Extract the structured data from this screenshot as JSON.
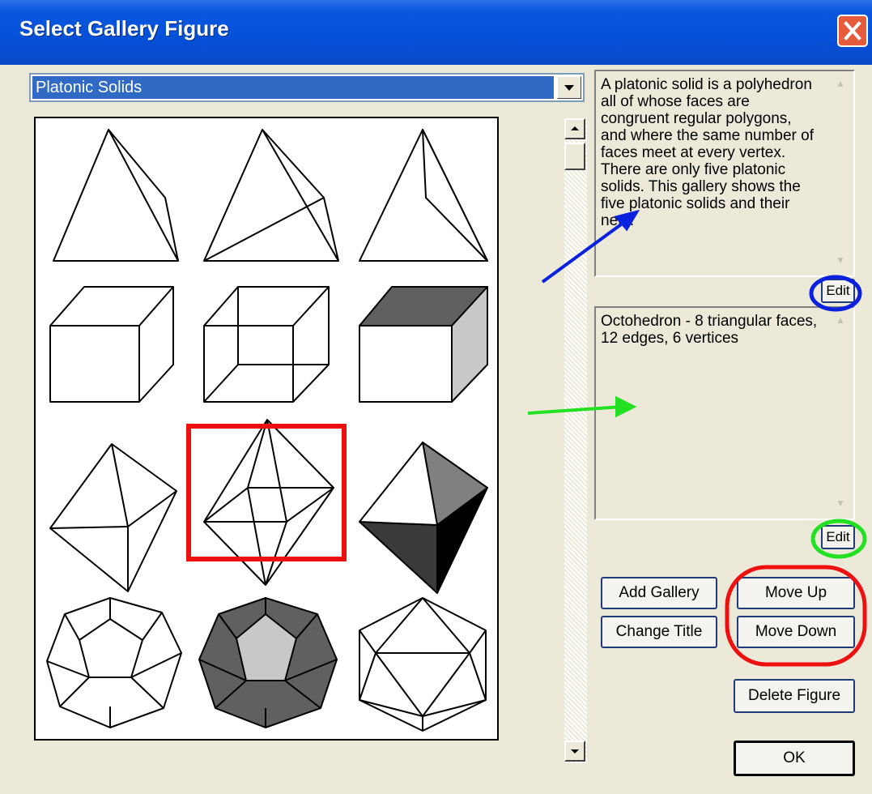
{
  "window": {
    "title": "Select Gallery Figure"
  },
  "gallery_select": {
    "selected": "Platonic Solids"
  },
  "description": "A platonic solid is a polyhedron all of whose faces are congruent regular polygons, and where the same number of faces meet at every vertex.  There are only five platonic solids.  This gallery shows the five platonic solids and their nets.",
  "figure_description": "Octohedron - 8 triangular faces, 12 edges, 6 vertices",
  "buttons": {
    "edit_description": "Edit",
    "edit_figure": "Edit",
    "add_gallery": "Add Gallery",
    "change_title": "Change Title",
    "move_up": "Move Up",
    "move_down": "Move Down",
    "delete_figure": "Delete Figure",
    "ok": "OK"
  },
  "figures": [
    "tetrahedron",
    "tetrahedron-hidden-lines",
    "tetrahedron-shaded",
    "cube",
    "cube-hidden-lines",
    "cube-shaded",
    "octahedron",
    "octahedron-hidden-lines",
    "octahedron-shaded",
    "dodecahedron",
    "dodecahedron-shaded",
    "icosahedron"
  ],
  "selected_figure": "octahedron-hidden-lines",
  "colors": {
    "titlebar": "#0550d8",
    "selection": "#316ac5",
    "annotation_blue": "#0a22e0",
    "annotation_green": "#22e022",
    "annotation_red": "#ee1010"
  }
}
